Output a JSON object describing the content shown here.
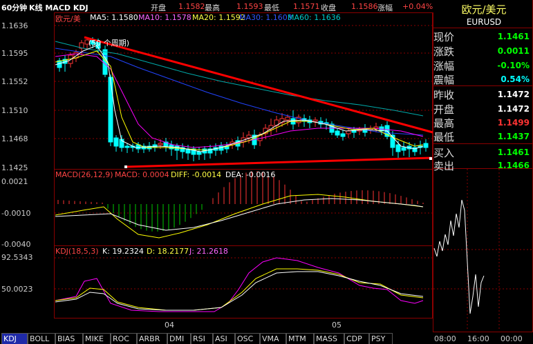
{
  "header": {
    "period_label": "60分钟",
    "indicators_label": "K线 MACD KDJ",
    "open_label": "开盘",
    "open_value": "1.1582",
    "high_label": "最高",
    "high_value": "1.1593",
    "low_label": "最低",
    "low_value": "1.1571",
    "close_label": "收盘",
    "close_value": "1.1586",
    "change_pct_label": "涨幅",
    "change_pct_value": "+0.04%"
  },
  "main_chart": {
    "symbol_label": "欧元/美",
    "ma5": "MA5: 1.1580",
    "ma10": "MA10: 1.1578",
    "ma20": "MA20: 1.1592",
    "ma30": "MA30: 1.1603",
    "ma60": "MA60: 1.1636",
    "annotation": "(50 个周期)",
    "y_ticks": [
      "1.1636",
      "1.1595",
      "1.1552",
      "1.1510",
      "1.1468",
      "1.1425"
    ]
  },
  "macd_panel": {
    "title": "MACD(26,12,9)",
    "macd": "MACD: 0.0004",
    "diff": "DIFF: -0.0014",
    "dea": "DEA: -0.0016",
    "y_ticks": [
      "0.0021",
      "-0.0010",
      "-0.0040"
    ]
  },
  "kdj_panel": {
    "title": "KDJ(18,5,3)",
    "k": "K: 19.2324",
    "d": "D: 18.2177",
    "j": "J: 21.2618",
    "y_ticks": [
      "92.5343",
      "50.0023"
    ]
  },
  "x_axis": {
    "labels": [
      "04",
      "05"
    ]
  },
  "tabs": [
    "KDJ",
    "BOLL",
    "BIAS",
    "MIKE",
    "ROC",
    "ARBR",
    "DMI",
    "RSI",
    "ASI",
    "OSC",
    "VMA",
    "MTM",
    "MASS",
    "CDP",
    "PSY"
  ],
  "right_panel": {
    "title": "欧元/美元",
    "code": "EURUSD",
    "rows": [
      {
        "label": "现价",
        "value": "1.1461",
        "color": "#00ff00"
      },
      {
        "label": "涨跌",
        "value": "0.0011",
        "color": "#00ff00"
      },
      {
        "label": "涨幅",
        "value": "-0.10%",
        "color": "#00ff00"
      },
      {
        "label": "震幅",
        "value": "0.54%",
        "color": "#00ffff"
      },
      {
        "label": "昨收",
        "value": "1.1472",
        "color": "#ffffff"
      },
      {
        "label": "开盘",
        "value": "1.1472",
        "color": "#ffffff"
      },
      {
        "label": "最高",
        "value": "1.1499",
        "color": "#ff3333"
      },
      {
        "label": "最低",
        "value": "1.1437",
        "color": "#00ff00"
      },
      {
        "label": "买入",
        "value": "1.1461",
        "color": "#00ff00"
      },
      {
        "label": "卖出",
        "value": "1.1466",
        "color": "#00ff00"
      }
    ],
    "time_labels": [
      "08:00",
      "16:00",
      "00:00"
    ]
  },
  "colors": {
    "grid": "#8b0000",
    "up": "#ff3333",
    "down": "#00ffff",
    "ma5": "#ffffff",
    "ma10": "#ffff00",
    "ma20": "#ff00ff",
    "ma30": "#2244ff",
    "ma60": "#00aaaa",
    "trendline": "#ff0000"
  }
}
